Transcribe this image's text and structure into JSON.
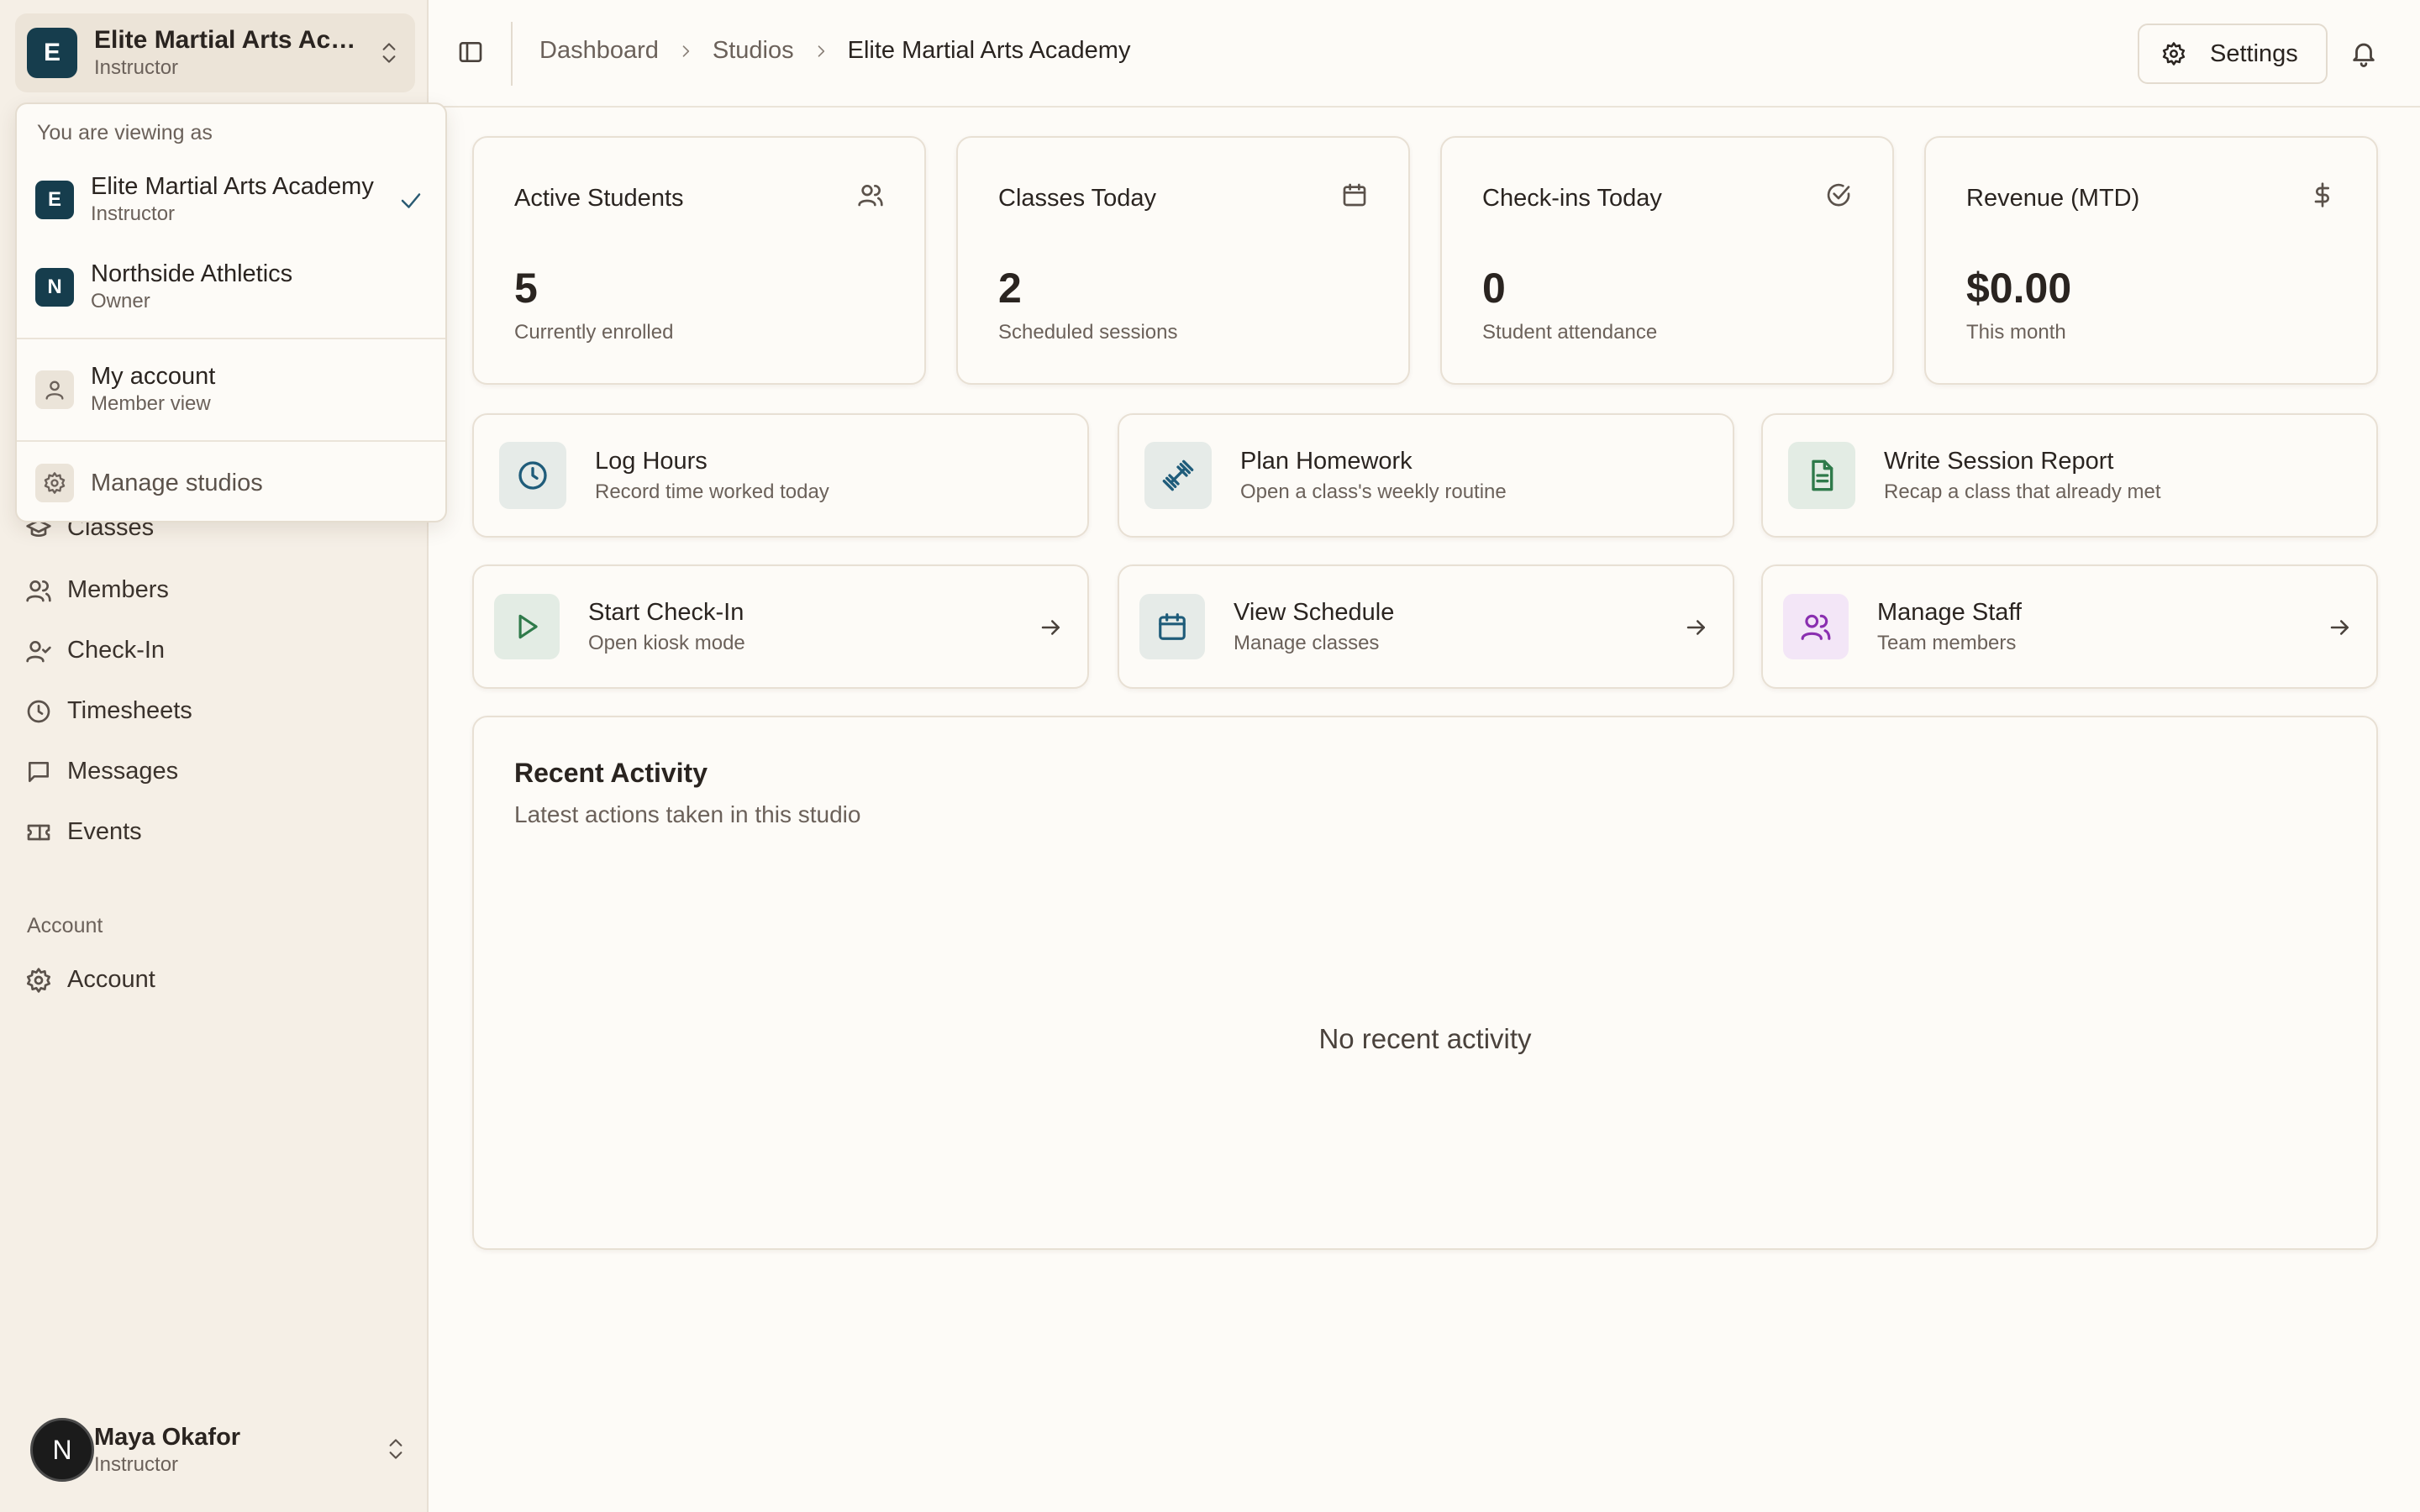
{
  "sidebar": {
    "studio": {
      "initial": "E",
      "name": "Elite Martial Arts Aca...",
      "role": "Instructor"
    },
    "nav_items": [
      {
        "label": "Classes",
        "icon": "graduation-cap-icon"
      },
      {
        "label": "Members",
        "icon": "users-icon"
      },
      {
        "label": "Check-In",
        "icon": "user-check-icon"
      },
      {
        "label": "Timesheets",
        "icon": "clock-icon"
      },
      {
        "label": "Messages",
        "icon": "message-icon"
      },
      {
        "label": "Events",
        "icon": "ticket-icon"
      }
    ],
    "account_section_label": "Account",
    "account_item": {
      "label": "Account",
      "icon": "gear-icon"
    },
    "user": {
      "initial": "N",
      "name": "Maya Okafor",
      "role": "Instructor"
    }
  },
  "dropdown": {
    "heading": "You are viewing as",
    "studios": [
      {
        "initial": "E",
        "name": "Elite Martial Arts Academy",
        "role": "Instructor",
        "selected": true
      },
      {
        "initial": "N",
        "name": "Northside Athletics",
        "role": "Owner",
        "selected": false
      }
    ],
    "my_account": {
      "name": "My account",
      "sub": "Member view"
    },
    "manage": "Manage studios"
  },
  "header": {
    "breadcrumbs": [
      "Dashboard",
      "Studios",
      "Elite Martial Arts Academy"
    ],
    "settings_label": "Settings"
  },
  "stats": [
    {
      "title": "Active Students",
      "value": "5",
      "sub": "Currently enrolled",
      "icon": "users-icon"
    },
    {
      "title": "Classes Today",
      "value": "2",
      "sub": "Scheduled sessions",
      "icon": "calendar-icon"
    },
    {
      "title": "Check-ins Today",
      "value": "0",
      "sub": "Student attendance",
      "icon": "check-circle-icon"
    },
    {
      "title": "Revenue (MTD)",
      "value": "$0.00",
      "sub": "This month",
      "icon": "dollar-icon"
    }
  ],
  "quick_actions": [
    {
      "title": "Log Hours",
      "sub": "Record time worked today",
      "icon": "clock-icon",
      "color": "#1f5c7a"
    },
    {
      "title": "Plan Homework",
      "sub": "Open a class's weekly routine",
      "icon": "dumbbell-icon",
      "color": "#1f5c7a"
    },
    {
      "title": "Write Session Report",
      "sub": "Recap a class that already met",
      "icon": "file-text-icon",
      "color": "#2f7a4a"
    }
  ],
  "nav_actions": [
    {
      "title": "Start Check-In",
      "sub": "Open kiosk mode",
      "icon": "play-icon",
      "color": "#2f7a4a"
    },
    {
      "title": "View Schedule",
      "sub": "Manage classes",
      "icon": "calendar-icon",
      "color": "#1f5c7a"
    },
    {
      "title": "Manage Staff",
      "sub": "Team members",
      "icon": "users-icon",
      "color": "#8a2fb0"
    }
  ],
  "activity": {
    "title": "Recent Activity",
    "subtitle": "Latest actions taken in this studio",
    "empty": "No recent activity"
  }
}
